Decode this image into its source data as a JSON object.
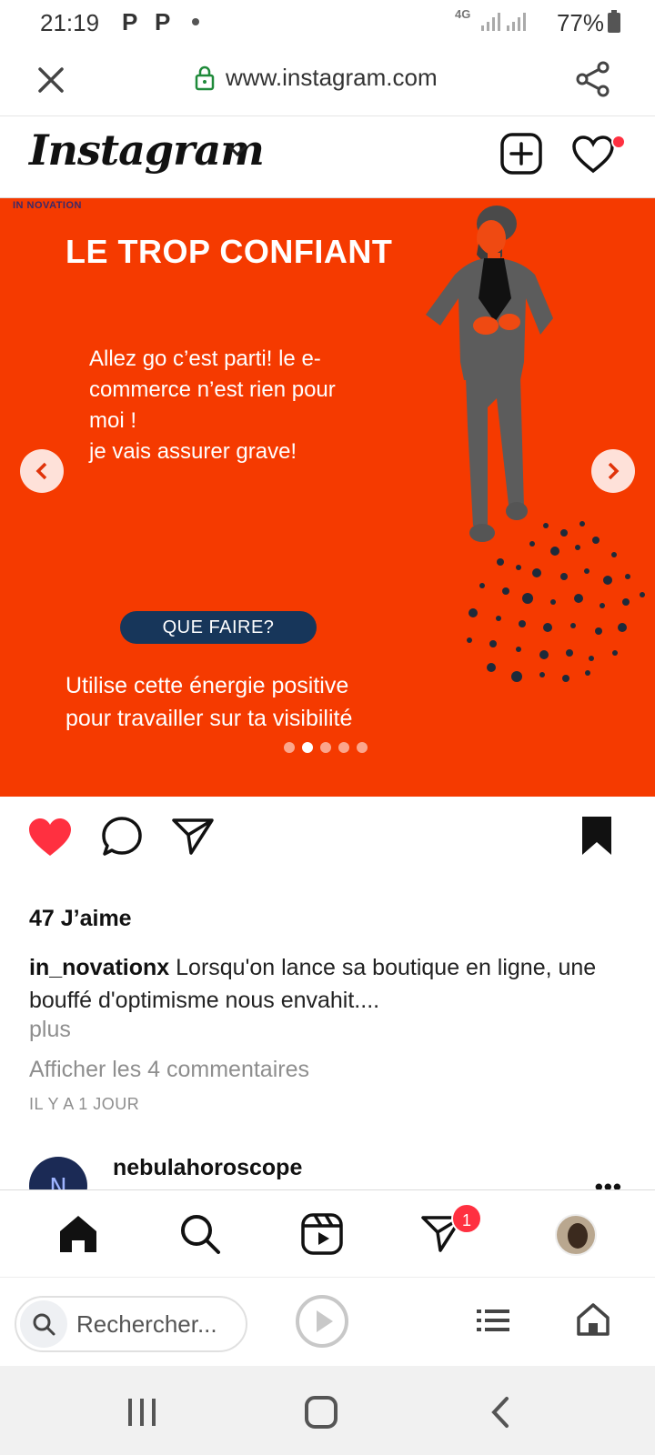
{
  "status_bar": {
    "time": "21:19",
    "notif_icons": [
      "P",
      "P"
    ],
    "network": "4G",
    "battery": "77%"
  },
  "browser": {
    "url": "www.instagram.com",
    "search_placeholder": "Rechercher..."
  },
  "header": {
    "logo": "Instagram"
  },
  "post": {
    "brand": "IN NOVATION",
    "title": "LE TROP CONFIANT",
    "body": "Allez go c’est parti! le e-\ncommerce n’est rien pour\nmoi !\nje vais assurer grave!",
    "cta": "QUE FAIRE?",
    "footer": "Utilise cette énergie positive\npour travailler sur ta visibilité",
    "carousel": {
      "count": 5,
      "active": 1
    },
    "likes": "47 J’aime",
    "username": "in_novationx",
    "caption": "Lorsqu'on lance sa boutique en ligne, une bouffé d'optimisme nous envahit....",
    "more": "plus",
    "comments_link": "Afficher les 4 commentaires",
    "time_ago": "IL Y A 1 JOUR"
  },
  "next_post": {
    "username": "nebulahoroscope",
    "menu": "•••"
  },
  "bottom_nav": {
    "activity_badge": "1"
  },
  "colors": {
    "post_bg": "#f53a00",
    "cta_bg": "#17365a",
    "like_red": "#ff3040"
  }
}
